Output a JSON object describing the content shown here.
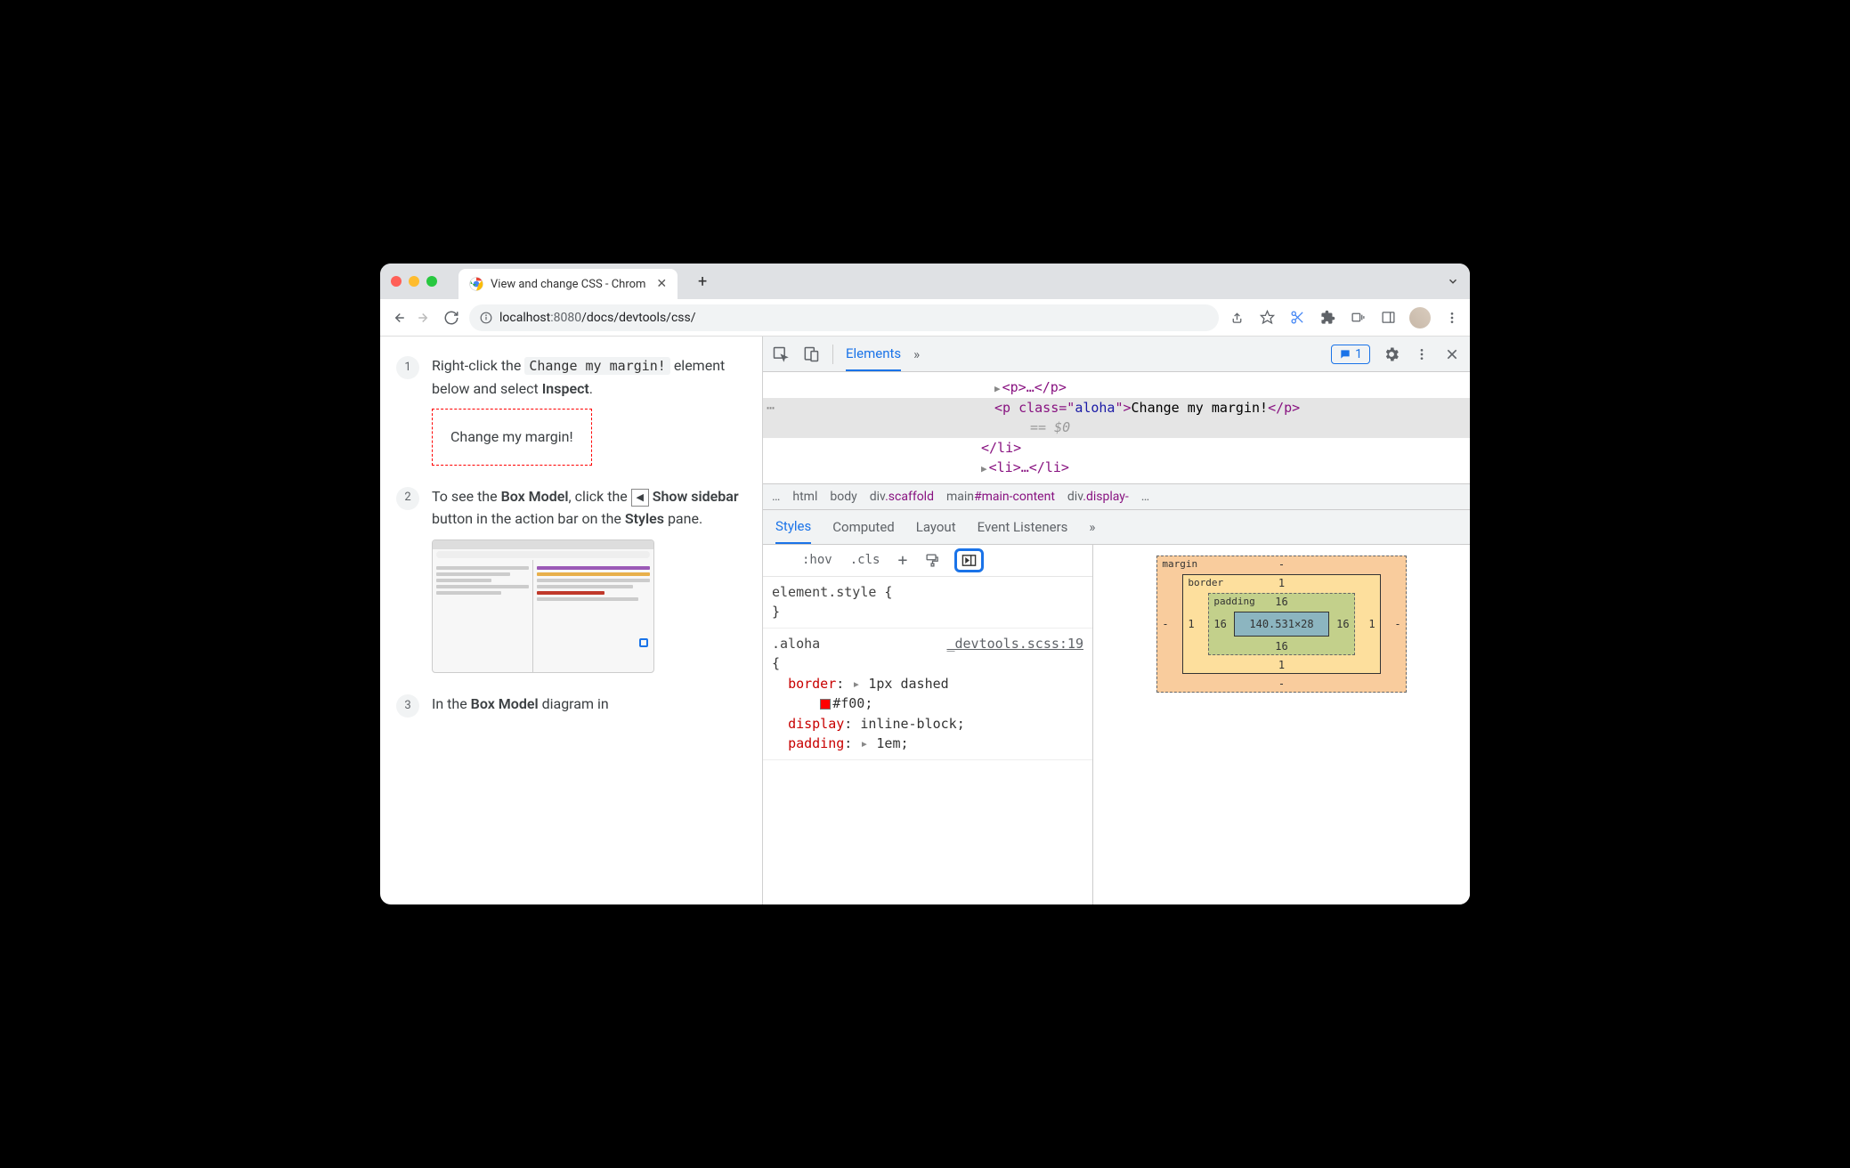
{
  "window": {
    "tab_title": "View and change CSS - Chrom"
  },
  "toolbar": {
    "url_host": "localhost",
    "url_port": ":8080",
    "url_path": "/docs/devtools/css/"
  },
  "page": {
    "steps": [
      {
        "num": "1",
        "pre": "Right-click the ",
        "code": "Change my margin!",
        "post_a": " element below and select ",
        "bold_a": "Inspect",
        "tail": "."
      },
      {
        "num": "2",
        "pre": "To see the ",
        "bold_a": "Box Model",
        "post_a": ", click the ",
        "icon": "◀",
        "bold_b": " Show sidebar",
        "post_b": " button in the action bar on the ",
        "bold_c": "Styles",
        "tail": " pane."
      },
      {
        "num": "3",
        "pre": "In the ",
        "bold_a": "Box Model",
        "post_a": " diagram in"
      }
    ],
    "target_text": "Change my margin!"
  },
  "devtools": {
    "tabs": {
      "elements": "Elements"
    },
    "issues_count": "1",
    "dom": {
      "p_ellip": "<p>…</p>",
      "sel_open": "<p class=\"",
      "sel_class": "aloha",
      "sel_mid": "\">",
      "sel_text": "Change my margin!",
      "sel_close": "</p>",
      "eq": "== $0",
      "li_close": "</li>",
      "li_ellip": "<li>…</li>"
    },
    "crumbs": {
      "html": "html",
      "body": "body",
      "div_scaffold_tag": "div",
      "div_scaffold_cls": ".scaffold",
      "main_tag": "main",
      "main_id": "#main-content",
      "div_display_tag": "div",
      "div_display_cls": ".display-"
    },
    "styles_tabs": {
      "styles": "Styles",
      "computed": "Computed",
      "layout": "Layout",
      "events": "Event Listeners"
    },
    "actions": {
      "hov": ":hov",
      "cls": ".cls"
    },
    "rules": {
      "element_style": "element.style",
      "aloha_sel": ".aloha",
      "aloha_src": "_devtools.scss:19",
      "border_prop": "border",
      "border_val": "1px dashed",
      "border_color": "#f00",
      "display_prop": "display",
      "display_val": "inline-block",
      "padding_prop": "padding",
      "padding_val": "1em"
    },
    "boxmodel": {
      "margin_label": "margin",
      "margin": "-",
      "border_label": "border",
      "border": "1",
      "padding_label": "padding",
      "padding": "16",
      "content": "140.531×28"
    }
  }
}
